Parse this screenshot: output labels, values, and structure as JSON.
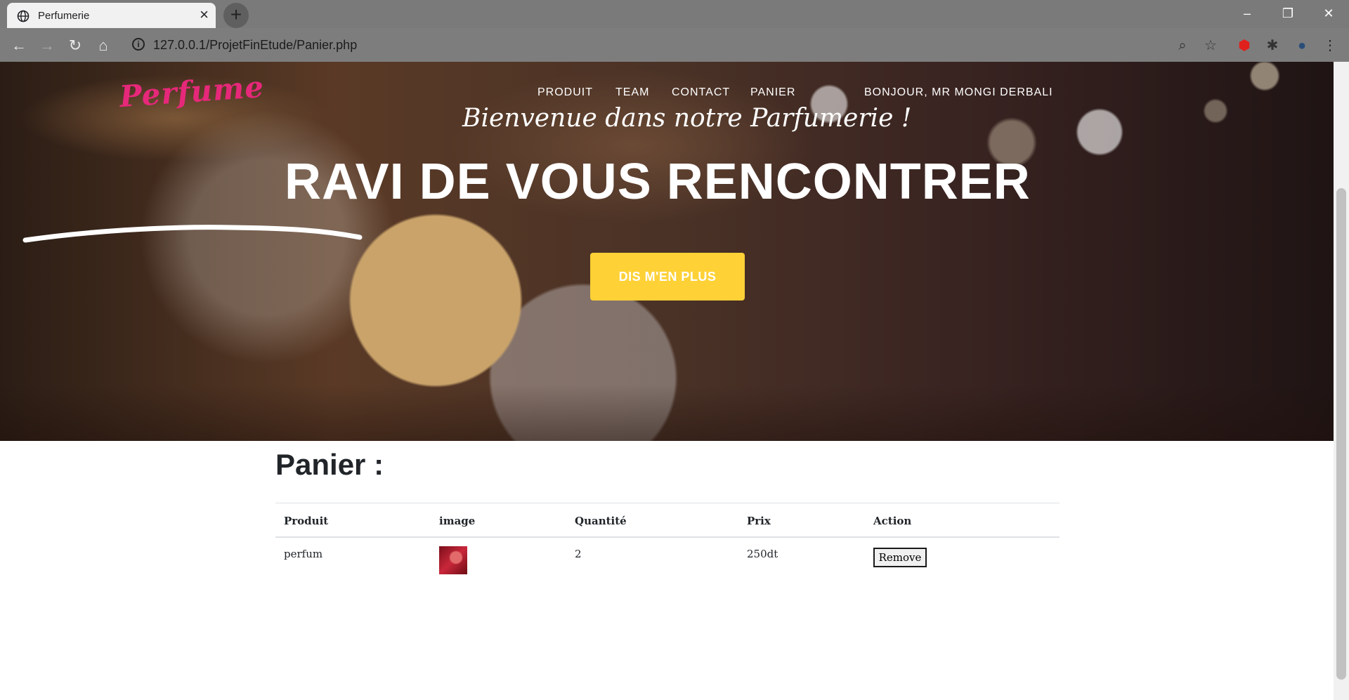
{
  "browser": {
    "tab_title": "Perfumerie",
    "url": "127.0.0.1/ProjetFinEtude/Panier.php",
    "new_tab_label": "+",
    "minimize_label": "–",
    "maximize_label": "❐",
    "close_label": "✕",
    "tab_close_label": "×"
  },
  "header": {
    "logo_text": "Perfume",
    "nav": [
      "PRODUIT",
      "TEAM",
      "CONTACT",
      "PANIER"
    ],
    "user_greeting": "BONJOUR, MR MONGI DERBALI",
    "welcome": "Bienvenue dans notre Parfumerie !",
    "headline": "RAVI DE VOUS RENCONTRER",
    "cta": "DIS M'EN PLUS"
  },
  "cart": {
    "title": "Panier :",
    "columns": [
      "Produit",
      "image",
      "Quantité",
      "Prix",
      "Action"
    ],
    "rows": [
      {
        "produit": "perfum",
        "quantite": "2",
        "prix": "250dt",
        "action": "Remove"
      }
    ]
  },
  "colors": {
    "accent": "#fed136",
    "logo": "#e6287a",
    "text_dark": "#212529"
  }
}
